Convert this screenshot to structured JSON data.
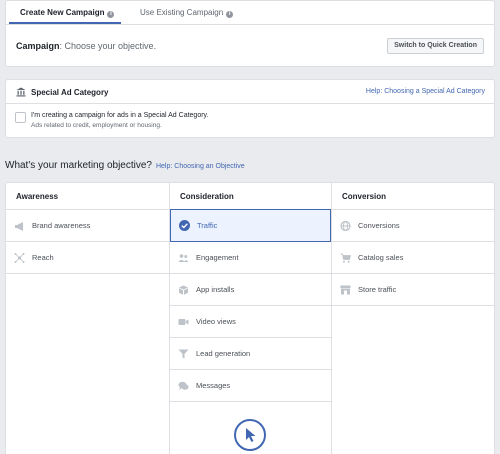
{
  "tabs": {
    "create_label": "Create New Campaign",
    "existing_label": "Use Existing Campaign",
    "info": "i"
  },
  "campaign": {
    "label": "Campaign",
    "subtitle": ": Choose your objective.",
    "quick_creation_label": "Switch to Quick Creation"
  },
  "special_ad": {
    "title": "Special Ad Category",
    "help_label": "Help: Choosing a Special Ad Category",
    "checkbox_label": "I'm creating a campaign for ads in a Special Ad Category.",
    "note": "Ads related to credit, employment or housing.",
    "checked": false
  },
  "objective": {
    "heading": "What's your marketing objective?",
    "help_label": "Help: Choosing an Objective"
  },
  "columns": [
    {
      "title": "Awareness",
      "items": [
        {
          "label": "Brand awareness",
          "icon": "megaphone-icon"
        },
        {
          "label": "Reach",
          "icon": "reach-icon"
        }
      ]
    },
    {
      "title": "Consideration",
      "items": [
        {
          "label": "Traffic",
          "icon": "check-circle-icon",
          "selected": true
        },
        {
          "label": "Engagement",
          "icon": "people-icon"
        },
        {
          "label": "App installs",
          "icon": "box-icon"
        },
        {
          "label": "Video views",
          "icon": "video-icon"
        },
        {
          "label": "Lead generation",
          "icon": "funnel-icon"
        },
        {
          "label": "Messages",
          "icon": "chat-icon"
        }
      ]
    },
    {
      "title": "Conversion",
      "items": [
        {
          "label": "Conversions",
          "icon": "globe-icon"
        },
        {
          "label": "Catalog sales",
          "icon": "cart-icon"
        },
        {
          "label": "Store traffic",
          "icon": "store-icon"
        }
      ]
    }
  ],
  "colors": {
    "accent": "#4267b2",
    "icon_gray": "#bec3c9",
    "selected_bg": "#ecf3ff"
  }
}
